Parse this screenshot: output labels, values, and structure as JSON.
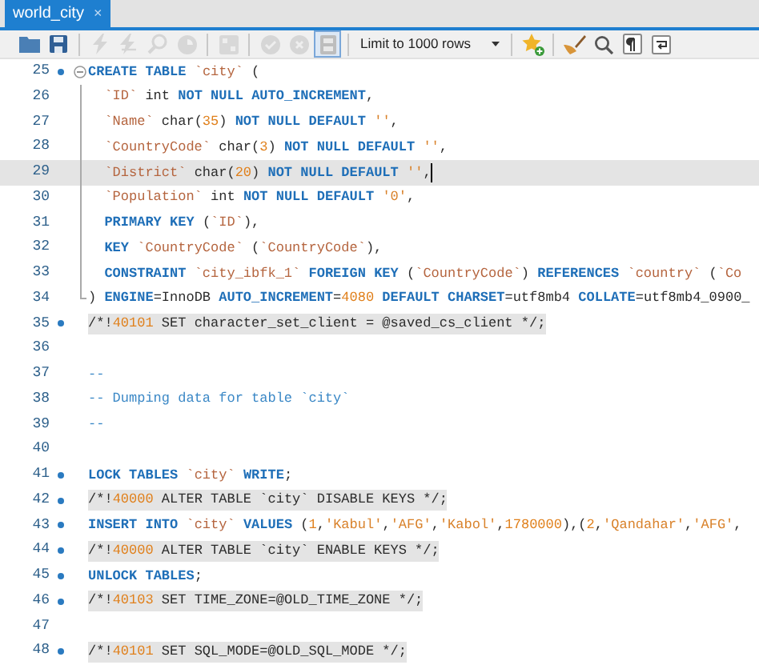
{
  "tabs": [
    {
      "label": "world_city",
      "close": "×",
      "selected": true
    }
  ],
  "toolbar": [
    {
      "kind": "open",
      "disabled": false,
      "pressed": false
    },
    {
      "kind": "save",
      "disabled": false,
      "pressed": false
    },
    {
      "kind": "separator"
    },
    {
      "kind": "execute",
      "disabled": true,
      "pressed": false
    },
    {
      "kind": "execute-current",
      "disabled": true,
      "pressed": false
    },
    {
      "kind": "explain",
      "disabled": true,
      "pressed": false
    },
    {
      "kind": "stop",
      "disabled": true,
      "pressed": false
    },
    {
      "kind": "separator"
    },
    {
      "kind": "error-toggle",
      "disabled": true,
      "pressed": false
    },
    {
      "kind": "separator"
    },
    {
      "kind": "commit",
      "disabled": true,
      "pressed": false
    },
    {
      "kind": "rollback",
      "disabled": true,
      "pressed": false
    },
    {
      "kind": "autocommit",
      "disabled": false,
      "pressed": true
    },
    {
      "kind": "separator"
    },
    {
      "kind": "limit",
      "label": "Limit to 1000 rows"
    },
    {
      "kind": "separator"
    },
    {
      "kind": "snippet",
      "disabled": false,
      "pressed": false
    },
    {
      "kind": "separator"
    },
    {
      "kind": "beautify",
      "disabled": false,
      "pressed": false
    },
    {
      "kind": "find",
      "disabled": false,
      "pressed": false
    },
    {
      "kind": "invisibles",
      "disabled": false,
      "pressed": false
    },
    {
      "kind": "wrap",
      "disabled": false,
      "pressed": false
    }
  ],
  "lines": [
    {
      "number": "25",
      "marker": true,
      "current": false,
      "highlight": false,
      "text": "CREATE TABLE `city` (",
      "children": [
        {
          "number": "26",
          "marker": false,
          "current": false,
          "highlight": false,
          "text": "  `ID` int NOT NULL AUTO_INCREMENT,"
        },
        {
          "number": "27",
          "marker": false,
          "current": false,
          "highlight": false,
          "text": "  `Name` char(35) NOT NULL DEFAULT '',"
        },
        {
          "number": "28",
          "marker": false,
          "current": false,
          "highlight": false,
          "text": "  `CountryCode` char(3) NOT NULL DEFAULT '',"
        },
        {
          "number": "29",
          "marker": false,
          "current": true,
          "highlight": false,
          "text": "  `District` char(20) NOT NULL DEFAULT '',"
        },
        {
          "number": "30",
          "marker": false,
          "current": false,
          "highlight": false,
          "text": "  `Population` int NOT NULL DEFAULT '0',"
        },
        {
          "number": "31",
          "marker": false,
          "current": false,
          "highlight": false,
          "text": "  PRIMARY KEY (`ID`),"
        },
        {
          "number": "32",
          "marker": false,
          "current": false,
          "highlight": false,
          "text": "  KEY `CountryCode` (`CountryCode`),"
        },
        {
          "number": "33",
          "marker": false,
          "current": false,
          "highlight": false,
          "text": "  CONSTRAINT `city_ibfk_1` FOREIGN KEY (`CountryCode`) REFERENCES `country` (`Co"
        },
        {
          "number": "34",
          "marker": false,
          "current": false,
          "highlight": false,
          "text": ") ENGINE=InnoDB AUTO_INCREMENT=4080 DEFAULT CHARSET=utf8mb4 COLLATE=utf8mb4_0900_"
        }
      ]
    },
    {
      "number": "35",
      "marker": true,
      "current": false,
      "highlight": true,
      "text": "/*!40101 SET character_set_client = @saved_cs_client */;"
    },
    {
      "number": "36",
      "marker": false,
      "current": false
    },
    {
      "number": "37",
      "marker": false,
      "current": false,
      "highlight": false,
      "text": "--"
    },
    {
      "number": "38",
      "marker": false,
      "current": false,
      "highlight": false,
      "text": "-- Dumping data for table `city`"
    },
    {
      "number": "39",
      "marker": false,
      "current": false,
      "highlight": false,
      "text": "--"
    },
    {
      "number": "40",
      "marker": false,
      "current": false
    },
    {
      "number": "41",
      "marker": true,
      "current": false,
      "highlight": false,
      "text": "LOCK TABLES `city` WRITE;"
    },
    {
      "number": "42",
      "marker": true,
      "current": false,
      "highlight": true,
      "text": "/*!40000 ALTER TABLE `city` DISABLE KEYS */;"
    },
    {
      "number": "43",
      "marker": true,
      "current": false,
      "highlight": false,
      "text": "INSERT INTO `city` VALUES (1,'Kabul','AFG','Kabol',1780000),(2,'Qandahar','AFG',"
    },
    {
      "number": "44",
      "marker": true,
      "current": false,
      "highlight": true,
      "text": "/*!40000 ALTER TABLE `city` ENABLE KEYS */;"
    },
    {
      "number": "45",
      "marker": true,
      "current": false,
      "highlight": false,
      "text": "UNLOCK TABLES;"
    },
    {
      "number": "46",
      "marker": true,
      "current": false,
      "highlight": true,
      "text": "/*!40103 SET TIME_ZONE=@OLD_TIME_ZONE */;"
    },
    {
      "number": "47",
      "marker": false,
      "current": false
    },
    {
      "number": "48",
      "marker": true,
      "current": false,
      "highlight": true,
      "text": "/*!40101 SET SQL_MODE=@OLD_SQL_MODE */;"
    }
  ]
}
